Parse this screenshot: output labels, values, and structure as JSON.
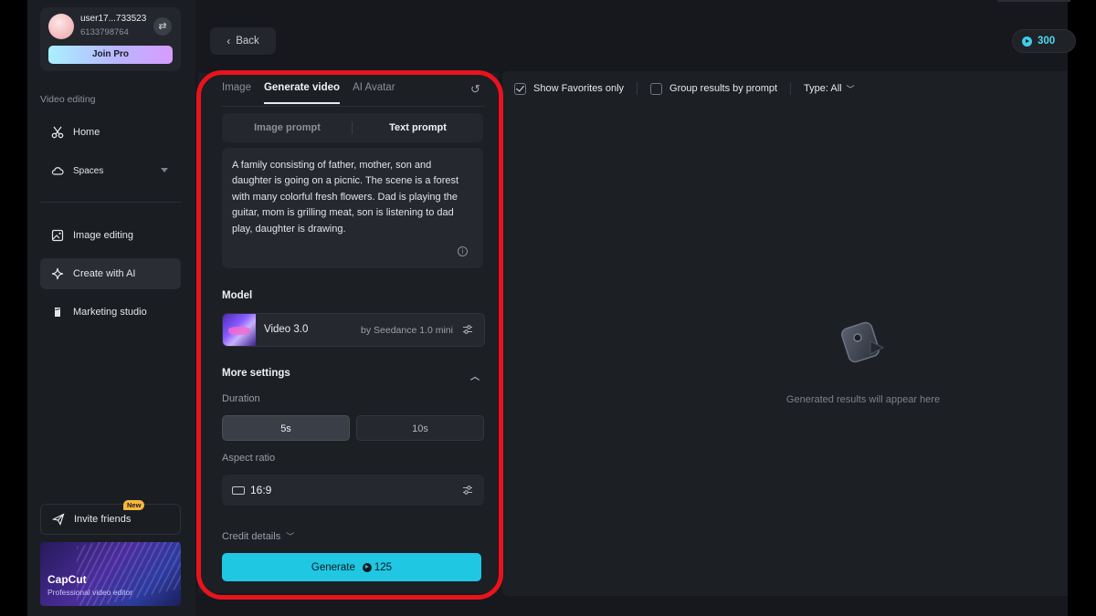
{
  "user": {
    "name": "user17...733523",
    "id": "6133798764",
    "join_pro_label": "Join Pro"
  },
  "sidebar": {
    "section_label": "Video editing",
    "items": [
      {
        "label": "Home",
        "icon": "scissors-icon"
      },
      {
        "label": "Spaces",
        "icon": "cloud-icon"
      },
      {
        "label": "Image editing",
        "icon": "image-icon"
      },
      {
        "label": "Create with AI",
        "icon": "sparkle-icon",
        "active": true
      },
      {
        "label": "Marketing studio",
        "icon": "bag-icon"
      }
    ],
    "invite_label": "Invite friends",
    "new_badge": "New",
    "promo_title": "CapCut",
    "promo_subtitle": "Professional video editor"
  },
  "header": {
    "back_label": "Back",
    "credits": "300"
  },
  "generator": {
    "tabs": [
      "Image",
      "Generate video",
      "AI Avatar"
    ],
    "active_tab": "Generate video",
    "mode_options": [
      "Image prompt",
      "Text prompt"
    ],
    "active_mode": "Text prompt",
    "prompt_text": "A family consisting of father, mother, son and daughter is going on a picnic. The scene is a forest with many colorful fresh flowers. Dad is playing the guitar, mom is grilling meat, son is listening to dad play, daughter is drawing.",
    "model_label": "Model",
    "model_name": "Video 3.0",
    "model_provider": "by Seedance 1.0 mini",
    "more_settings_label": "More settings",
    "duration_label": "Duration",
    "duration_options": [
      "5s",
      "10s"
    ],
    "selected_duration": "5s",
    "aspect_ratio_label": "Aspect ratio",
    "aspect_ratio_value": "16:9",
    "credit_details_label": "Credit details",
    "generate_label": "Generate",
    "generate_cost": "125"
  },
  "results": {
    "show_favorites_label": "Show Favorites only",
    "show_favorites_checked": true,
    "group_results_label": "Group results by prompt",
    "group_results_checked": false,
    "type_filter_label": "Type: All",
    "empty_message": "Generated results will appear here"
  },
  "colors": {
    "accent": "#1fc7e3",
    "highlight_border": "#e8131c",
    "background": "#16181d"
  }
}
